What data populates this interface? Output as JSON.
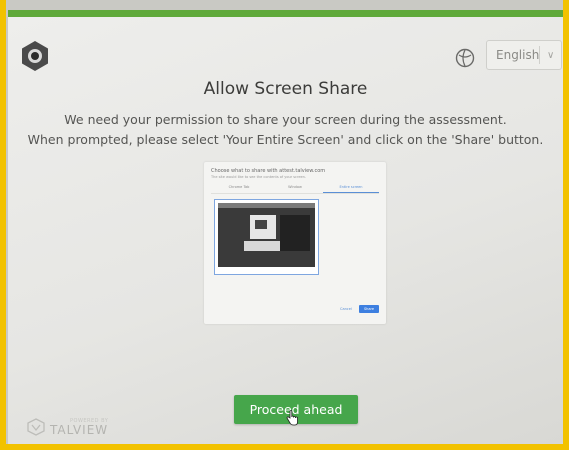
{
  "header": {
    "language_select": {
      "value": "English"
    }
  },
  "main": {
    "title": "Allow Screen Share",
    "description_line1": "We need your permission to share your screen during the assessment.",
    "description_line2": "When prompted, please select 'Your Entire Screen' and click on the 'Share' button."
  },
  "preview": {
    "heading": "Choose what to share with attest.talview.com",
    "subheading": "The site would like to see the contents of your screen.",
    "tabs": [
      {
        "label": "Chrome Tab"
      },
      {
        "label": "Window"
      },
      {
        "label": "Entire screen"
      }
    ],
    "cancel_label": "Cancel",
    "share_label": "Share"
  },
  "actions": {
    "proceed_label": "Proceed ahead"
  },
  "footer": {
    "brand_small": "POWERED BY",
    "brand_name": "TALVIEW"
  },
  "colors": {
    "accent_green": "#46a64b",
    "top_bar_green": "#5fa93a",
    "share_blue": "#3d7fe0"
  }
}
